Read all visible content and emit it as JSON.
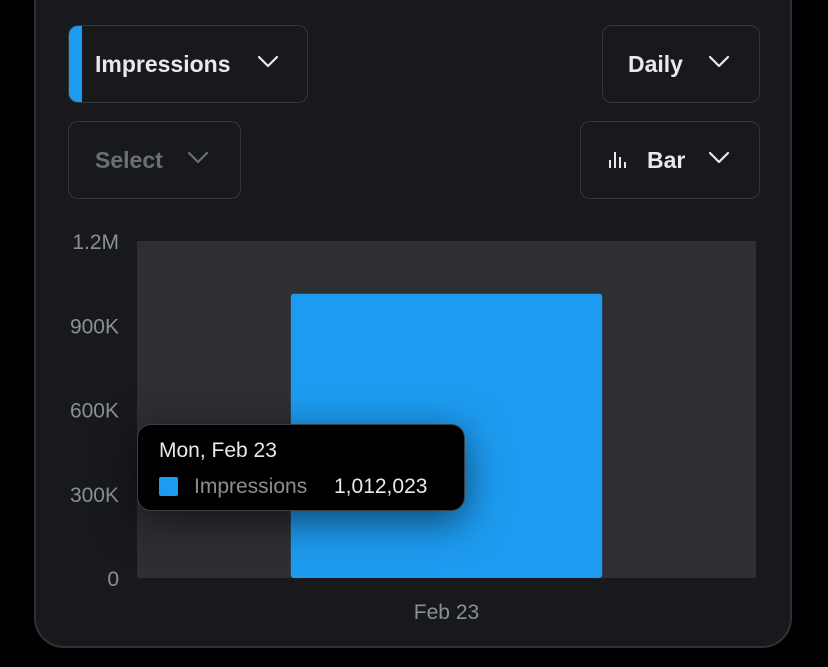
{
  "controls": {
    "metric": "Impressions",
    "compare_placeholder": "Select",
    "period": "Daily",
    "chart_type": "Bar"
  },
  "icons": {
    "chevron": "chevron-down-icon",
    "chart_type": "bar-chart-icon"
  },
  "colors": {
    "accent": "#1d9bf0",
    "plot_background": "#2e2f33",
    "card_background": "#18191d"
  },
  "tooltip": {
    "date": "Mon, Feb 23",
    "series": "Impressions",
    "value": "1,012,023"
  },
  "chart_data": {
    "type": "bar",
    "categories": [
      "Feb 23"
    ],
    "series": [
      {
        "name": "Impressions",
        "values": [
          1012023
        ],
        "color": "#1d9bf0"
      }
    ],
    "ylim": [
      0,
      1200000
    ],
    "yticks": [
      0,
      300000,
      600000,
      900000,
      1200000
    ],
    "ytick_labels": [
      "0",
      "300K",
      "600K",
      "900K",
      "1.2M"
    ],
    "grid": false
  }
}
